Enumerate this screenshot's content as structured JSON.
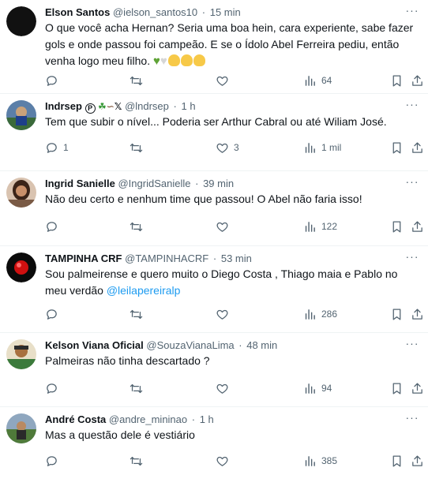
{
  "tweets": [
    {
      "name": "Elson Santos",
      "handle": "@ielson_santos10",
      "time": "15 min",
      "text": "O que você acha Hernan? Seria uma boa hein, cara experiente, sabe  fazer gols e onde passou foi campeão. E se o Ídolo Abel Ferreira pediu, então venha logo meu filho.",
      "emoji": [
        "green-heart",
        "white-heart",
        "clapping-hands",
        "clapping-hands",
        "clapping-hands"
      ],
      "replies": "",
      "retweets": "",
      "likes": "",
      "views": "64"
    },
    {
      "name": "Indrsep",
      "name_suffix": "🄟☘",
      "name_suffix2": "𝕏",
      "handle": "@lndrsep",
      "time": "1 h",
      "text": "Tem que subir o nível... Poderia ser Arthur Cabral ou até Wiliam José.",
      "replies": "1",
      "retweets": "",
      "likes": "3",
      "views": "1 mil"
    },
    {
      "name": "Ingrid Sanielle",
      "handle": "@IngridSanielle",
      "time": "39 min",
      "text": "Não deu certo e nenhum time que passou! O Abel não faria isso!",
      "replies": "",
      "retweets": "",
      "likes": "",
      "views": "122"
    },
    {
      "name": "TAMPINHA CRF",
      "handle": "@TAMPINHACRF",
      "time": "53 min",
      "text": "Sou palmeirense e quero muito o Diego Costa , Thiago maia e Pablo no meu verdão",
      "mention": "@leilapereiralp",
      "replies": "",
      "retweets": "",
      "likes": "",
      "views": "286"
    },
    {
      "name": "Kelson Viana Oficial",
      "handle": "@SouzaVianaLima",
      "time": "48 min",
      "text": "Palmeiras não tinha descartado ?",
      "replies": "",
      "retweets": "",
      "likes": "",
      "views": "94"
    },
    {
      "name": "André Costa",
      "handle": "@andre_mininao",
      "time": "1 h",
      "text": "Mas a questão dele é vestiário",
      "replies": "",
      "retweets": "",
      "likes": "",
      "views": "385"
    }
  ],
  "colors": {
    "text": "#0f1419",
    "secondary": "#536471",
    "link": "#1d9bf0",
    "divider": "#eff3f4"
  },
  "icons": {
    "reply": "reply-icon",
    "retweet": "retweet-icon",
    "like": "heart-icon",
    "views": "views-bar-chart-icon",
    "bookmark": "bookmark-icon",
    "share": "share-icon",
    "more": "more-dots-icon"
  }
}
